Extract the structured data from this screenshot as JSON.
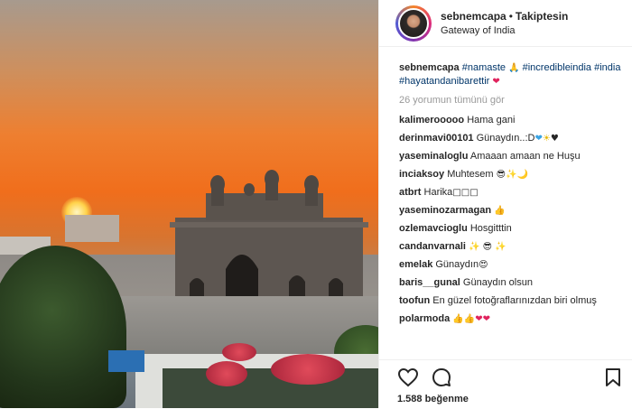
{
  "header": {
    "username": "sebnemcapa",
    "follow_status": "Takiptesin",
    "location": "Gateway of India"
  },
  "caption": {
    "username": "sebnemcapa",
    "tags_line1": [
      "#namaste",
      "#incredibleindia"
    ],
    "tags_line2": [
      "#india",
      "#hayatandanibarettir"
    ]
  },
  "view_all_comments": "26 yorumun tümünü gör",
  "comments": [
    {
      "user": "kalimerooooo",
      "text": "Hama gani"
    },
    {
      "user": "derinmavi00101",
      "text": "Günaydın..:D"
    },
    {
      "user": "yaseminaloglu",
      "text": "Amaaan amaan ne Huşu"
    },
    {
      "user": "inciaksoy",
      "text": "Muhtesem"
    },
    {
      "user": "atbrt",
      "text": "Harika"
    },
    {
      "user": "yaseminozarmagan",
      "text": ""
    },
    {
      "user": "ozlemavcioglu",
      "text": "Hosgitttin"
    },
    {
      "user": "candanvarnali",
      "text": ""
    },
    {
      "user": "emelak",
      "text": "Günaydın"
    },
    {
      "user": "baris__gunal",
      "text": "Günaydın olsun"
    },
    {
      "user": "toofun",
      "text": "En güzel fotoğraflarınızdan biri olmuş"
    },
    {
      "user": "polarmoda",
      "text": ""
    }
  ],
  "likes": "1.588 beğenme",
  "icons": {
    "like": "heart-icon",
    "comment": "comment-icon",
    "save": "bookmark-icon"
  }
}
